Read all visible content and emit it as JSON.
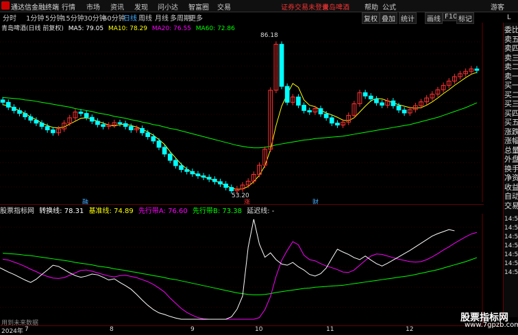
{
  "app": {
    "title": "通达信金融终端",
    "notice": "证券交易未登录",
    "notice_stock": "青岛啤酒",
    "guest": "游客",
    "sidebar_header": "L"
  },
  "menu": [
    "行情",
    "市场",
    "资讯",
    "发现",
    "问小达",
    "智富圈",
    "交易"
  ],
  "top_right": [
    "帮助",
    "公式"
  ],
  "periods": [
    "分时",
    "1分钟",
    "5分钟",
    "15分钟",
    "30分钟",
    "60分钟",
    "日线",
    "周线",
    "月线",
    "多周期",
    "更多"
  ],
  "active_period": "日线",
  "tools": [
    "复权",
    "叠加",
    "统计",
    "画线",
    "F10",
    "标记"
  ],
  "legend": {
    "stock": "青岛啤酒(日线 前复权)",
    "ma5": "MA5: 79.05",
    "ma10": "MA10: 78.29",
    "ma20": "MA20: 76.55",
    "ma60": "MA60: 72.86"
  },
  "indicator": {
    "name": "股票指标网",
    "line1": "转换线: 78.31",
    "line2": "基准线: 74.89",
    "line3": "先行带A: 76.60",
    "line4": "先行带B: 73.38",
    "line5": "延迟线: -"
  },
  "annotations": {
    "high": "86.18",
    "low": "53.20"
  },
  "markers": [
    "融",
    "涨",
    "财"
  ],
  "right_panel": [
    "委比",
    "卖五",
    "卖四",
    "卖三",
    "卖二",
    "卖一",
    "买一",
    "买二",
    "买三",
    "买四",
    "买五",
    "涨跌",
    "涨幅",
    "总量",
    "外盘",
    "换手",
    "净资",
    "收益",
    "自动",
    "交易"
  ],
  "right_times": [
    "14:50",
    "14:50",
    "14:50",
    "14:50",
    "14:50",
    "14:50",
    "14:50"
  ],
  "footnote": "用到未来数据",
  "watermark": {
    "line1": "股票指标网",
    "line2": "www.7gpzb.com"
  },
  "dates": [
    "2024年",
    "7",
    "8",
    "9",
    "10",
    "11",
    "12"
  ],
  "colors": {
    "up": "#ff3333",
    "down": "#00ffff",
    "ma5": "#ffffff",
    "ma10": "#ffff00",
    "ma20": "#ff00ff",
    "ma60": "#00ff00"
  },
  "chart_data": {
    "type": "line",
    "y_ticks_main": [
      55.0,
      57.5,
      60.0,
      62.5,
      65.0,
      67.5,
      70.0,
      72.5,
      75.0,
      77.5,
      80.0,
      82.5,
      85.0
    ],
    "y_ticks_indicator": [
      60.0,
      65.0,
      70.0,
      75.0,
      80.0
    ],
    "ylim_main": [
      53,
      87
    ],
    "ylim_indicator": [
      57,
      82
    ],
    "close": [
      72.5,
      71.5,
      70.8,
      70.2,
      69.5,
      68.8,
      68.2,
      67.5,
      66.8,
      66.2,
      67.0,
      68.2,
      69.3,
      70.5,
      70.2,
      69.4,
      68.6,
      67.9,
      67.5,
      67.8,
      68.3,
      68.1,
      67.5,
      66.8,
      67.1,
      66.2,
      65.4,
      64.5,
      63.2,
      61.8,
      60.5,
      59.4,
      58.6,
      58.2,
      57.7,
      57.3,
      57.0,
      56.6,
      56.1,
      55.6,
      54.9,
      54.2,
      54.6,
      55.4,
      56.2,
      57.6,
      59.5,
      62.8,
      75.0,
      84.5,
      75.8,
      72.5,
      73.6,
      71.9,
      70.8,
      70.5,
      71.2,
      70.1,
      69.3,
      68.2,
      67.8,
      68.4,
      69.8,
      72.2,
      74.5,
      73.8,
      73.2,
      72.4,
      71.9,
      72.8,
      71.8,
      70.9,
      70.3,
      71.0,
      71.8,
      72.6,
      73.4,
      74.2,
      75.1,
      76.0,
      76.9,
      77.8,
      78.4,
      78.9,
      79.4,
      79.1
    ],
    "ma5": [
      72.0,
      71.8,
      71.3,
      70.8,
      70.2,
      69.5,
      68.9,
      68.2,
      67.7,
      67.3,
      67.2,
      67.4,
      68.0,
      68.6,
      69.2,
      69.3,
      69.0,
      68.6,
      68.2,
      67.8,
      67.6,
      67.9,
      68.0,
      67.7,
      67.4,
      66.9,
      66.4,
      65.7,
      64.8,
      63.8,
      62.3,
      61.0,
      59.7,
      58.7,
      58.0,
      57.4,
      57.1,
      56.7,
      56.3,
      55.8,
      55.3,
      54.8,
      54.5,
      54.6,
      55.1,
      56.1,
      57.4,
      59.4,
      62.7,
      67.7,
      71.7,
      74.2,
      76.4,
      75.6,
      73.0,
      71.9,
      71.6,
      70.9,
      70.3,
      69.9,
      69.4,
      68.8,
      68.7,
      69.3,
      70.5,
      71.7,
      72.8,
      73.3,
      73.2,
      72.8,
      72.4,
      72.0,
      71.7,
      71.4,
      71.3,
      71.4,
      71.9,
      72.6,
      73.4,
      74.3,
      75.1,
      76.0,
      76.8,
      77.6,
      78.3,
      78.7
    ],
    "ma60": [
      73.5,
      73.4,
      73.3,
      73.2,
      73.0,
      72.9,
      72.7,
      72.5,
      72.3,
      72.1,
      71.9,
      71.7,
      71.5,
      71.2,
      71.0,
      70.8,
      70.6,
      70.3,
      70.1,
      69.9,
      69.6,
      69.4,
      69.2,
      68.9,
      68.7,
      68.4,
      68.2,
      67.9,
      67.7,
      67.4,
      67.1,
      66.9,
      66.6,
      66.3,
      66.0,
      65.7,
      65.4,
      65.1,
      64.8,
      64.5,
      64.2,
      63.9,
      63.6,
      63.4,
      63.2,
      63.1,
      63.1,
      63.2,
      63.4,
      63.7,
      63.9,
      64.1,
      64.3,
      64.5,
      64.7,
      64.8,
      65.0,
      65.1,
      65.2,
      65.3,
      65.4,
      65.5,
      65.7,
      65.9,
      66.1,
      66.3,
      66.5,
      66.7,
      66.9,
      67.1,
      67.3,
      67.5,
      67.7,
      67.9,
      68.2,
      68.5,
      68.8,
      69.1,
      69.4,
      69.8,
      70.2,
      70.6,
      71.0,
      71.4,
      71.9,
      72.4
    ]
  }
}
